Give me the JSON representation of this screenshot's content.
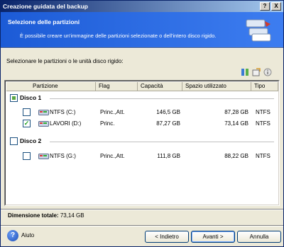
{
  "window": {
    "title": "Creazione guidata del backup",
    "help_btn": "?",
    "close_btn": "X"
  },
  "header": {
    "title": "Selezione delle partizioni",
    "subtitle": "È possibile creare un'immagine delle partizioni selezionate o dell'intero disco rigido."
  },
  "instruction": "Selezionare le partizioni o le unità disco rigido:",
  "columns": [
    "Partizione",
    "Flag",
    "Capacità",
    "Spazio utilizzato",
    "Tipo"
  ],
  "disks": [
    {
      "label": "Disco 1",
      "checked": "partial",
      "partitions": [
        {
          "name": "NTFS (C:)",
          "flag": "Princ.,Att.",
          "capacity": "146,5 GB",
          "used": "87,28 GB",
          "type": "NTFS",
          "checked": false
        },
        {
          "name": "LAVORI (D:)",
          "flag": "Princ.",
          "capacity": "87,27 GB",
          "used": "73,14 GB",
          "type": "NTFS",
          "checked": true
        }
      ]
    },
    {
      "label": "Disco 2",
      "checked": "none",
      "partitions": [
        {
          "name": "NTFS (G:)",
          "flag": "Princ.,Att.",
          "capacity": "111,8 GB",
          "used": "88,22 GB",
          "type": "NTFS",
          "checked": false
        }
      ]
    }
  ],
  "total": {
    "label": "Dimensione totale:",
    "value": "73,14 GB"
  },
  "footer": {
    "help": "Aiuto",
    "back": "< Indietro",
    "next": "Avanti >",
    "cancel": "Annulla"
  },
  "icons": {
    "help": "help-icon",
    "toolbar": [
      "columns-icon",
      "properties-icon",
      "info-icon"
    ]
  }
}
